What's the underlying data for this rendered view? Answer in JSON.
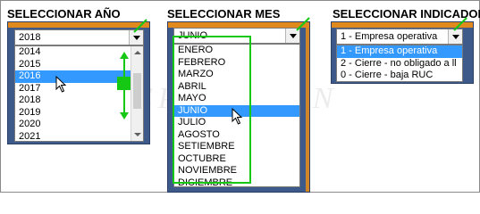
{
  "watermark": "EPSINATEN",
  "year": {
    "title": "SELECCIONAR AÑO",
    "selected_value": "2018",
    "items": [
      "2014",
      "2015",
      "2016",
      "2017",
      "2018",
      "2019",
      "2020",
      "2021"
    ],
    "highlighted_index": 2
  },
  "month": {
    "title": "SELECCIONAR MES",
    "selected_value": "JUNIO",
    "items": [
      "ENERO",
      "FEBRERO",
      "MARZO",
      "ABRIL",
      "MAYO",
      "JUNIO",
      "JULIO",
      "AGOSTO",
      "SETIEMBRE",
      "OCTUBRE",
      "NOVIEMBRE",
      "DICIEMBRE"
    ],
    "highlighted_index": 5
  },
  "indicator": {
    "title": "SELECCIONAR INDICADOR",
    "selected_value": "1 - Empresa operativa",
    "items": [
      "1 - Empresa operativa",
      "2 - Cierre - no obligado a ll",
      "0 - Cierre - baja RUC"
    ],
    "highlighted_index": 0
  },
  "colors": {
    "highlight": "#3399ff",
    "annotation": "#14c814",
    "panel": "#3d5a8a",
    "accent": "#e08a1e"
  },
  "icons": [
    "chevron-down-icon",
    "mouse-pointer-icon",
    "scroll-up-arrow-icon",
    "scroll-down-arrow-icon"
  ]
}
